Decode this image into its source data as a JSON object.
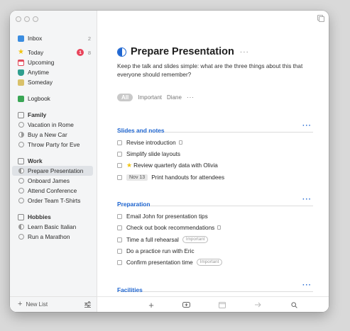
{
  "sidebar": {
    "inbox": {
      "label": "Inbox",
      "count": "2"
    },
    "today": {
      "label": "Today",
      "badge": "1",
      "count": "8"
    },
    "upcoming": {
      "label": "Upcoming"
    },
    "anytime": {
      "label": "Anytime"
    },
    "someday": {
      "label": "Someday"
    },
    "logbook": {
      "label": "Logbook"
    },
    "areas": [
      {
        "label": "Family",
        "projects": [
          "Vacation in Rome",
          "Buy a New Car",
          "Throw Party for Eve"
        ]
      },
      {
        "label": "Work",
        "projects": [
          "Prepare Presentation",
          "Onboard James",
          "Attend Conference",
          "Order Team T-Shirts"
        ]
      },
      {
        "label": "Hobbies",
        "projects": [
          "Learn Basic Italian",
          "Run a Marathon"
        ]
      }
    ],
    "new_list": "New List"
  },
  "project": {
    "title": "Prepare Presentation",
    "more": "···",
    "notes": "Keep the talk and slides simple: what are the three things about this that everyone should remember?",
    "tags": [
      "All",
      "Important",
      "Diane"
    ],
    "tags_more": "···"
  },
  "headings": [
    {
      "label": "Slides and notes",
      "more": "···",
      "todos": [
        {
          "text": "Revise introduction"
        },
        {
          "text": "Simplify slide layouts"
        },
        {
          "text": "Review quarterly data with Olivia"
        },
        {
          "date": "Nov 13",
          "text": "Print handouts for attendees"
        }
      ]
    },
    {
      "label": "Preparation",
      "more": "···",
      "todos": [
        {
          "text": "Email John for presentation tips"
        },
        {
          "text": "Check out book recommendations"
        },
        {
          "text": "Time a full rehearsal",
          "tag": "Important"
        },
        {
          "text": "Do a practice run with Eric"
        },
        {
          "text": "Confirm presentation time",
          "tag": "Important"
        }
      ]
    },
    {
      "label": "Facilities",
      "more": "···"
    }
  ],
  "colors": {
    "accent": "#1f66d1",
    "badge": "#e8435a",
    "star": "#f1c40f"
  }
}
